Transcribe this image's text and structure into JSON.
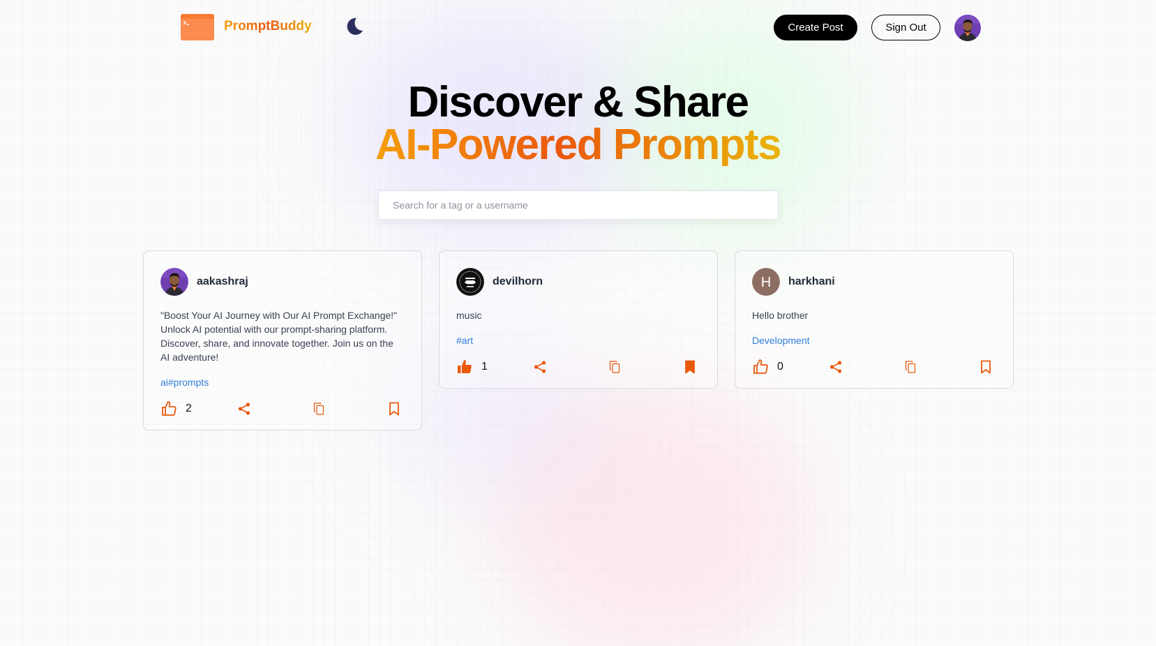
{
  "nav": {
    "brand": "PromptBuddy",
    "create_post_label": "Create Post",
    "sign_out_label": "Sign Out",
    "logo_icon": "browser-window-logo",
    "theme_icon": "moon-icon"
  },
  "hero": {
    "line1": "Discover & Share",
    "line2": "AI-Powered Prompts"
  },
  "search": {
    "placeholder": "Search for a tag or a username",
    "value": ""
  },
  "colors": {
    "accent_orange": "#ea580c",
    "gradient": [
      "#f59e0b",
      "#ea580c",
      "#eab308"
    ],
    "tag_blue": "#2f7ed8"
  },
  "posts": [
    {
      "username": "aakashraj",
      "prompt": "\"Boost Your AI Journey with Our AI Prompt Exchange!\" Unlock AI potential with our prompt-sharing platform. Discover, share, and innovate together. Join us on the AI adventure!",
      "tag": "ai#prompts",
      "likes": "2",
      "liked": false,
      "saved": false,
      "avatar": "photo"
    },
    {
      "username": "devilhorn",
      "prompt": "music",
      "tag": "#art",
      "likes": "1",
      "liked": true,
      "saved": true,
      "avatar": "badge-logo"
    },
    {
      "username": "harkhani",
      "prompt": "Hello brother",
      "tag": "Development",
      "likes": "0",
      "liked": false,
      "saved": false,
      "avatar": "initial",
      "initial": "H"
    }
  ]
}
